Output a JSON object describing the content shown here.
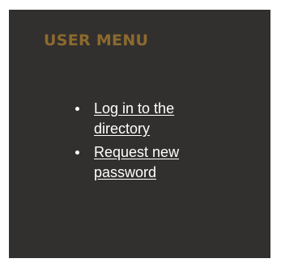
{
  "user_menu": {
    "title": "USER MENU",
    "title_color": "#8c6a2e",
    "panel_color": "#32302e",
    "items": [
      {
        "label": "Log in to the directory",
        "bullet": "bullet-icon"
      },
      {
        "label": "Request new password",
        "bullet": "bullet-icon"
      }
    ]
  }
}
